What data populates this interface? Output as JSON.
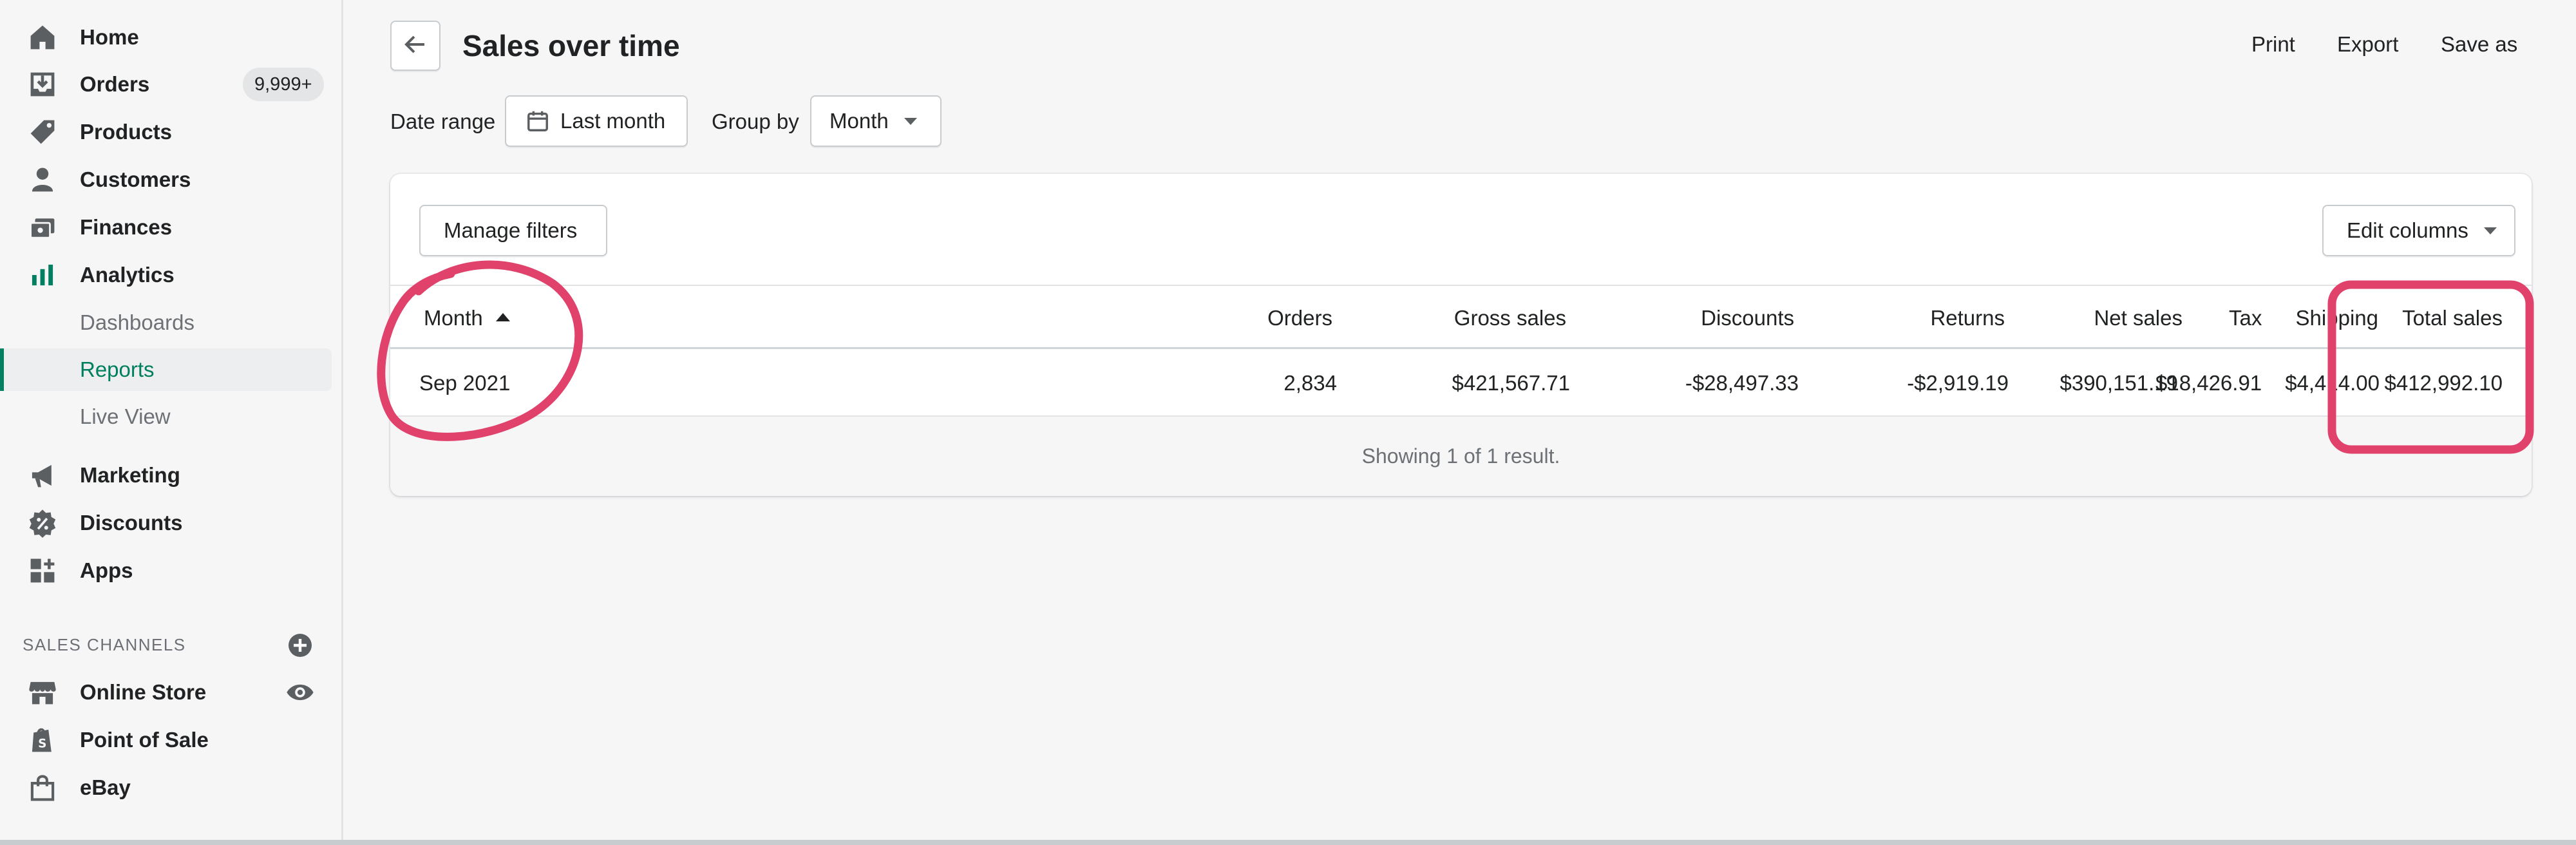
{
  "sidebar": {
    "items": [
      {
        "label": "Home",
        "icon": "home-icon"
      },
      {
        "label": "Orders",
        "icon": "orders-icon",
        "badge": "9,999+"
      },
      {
        "label": "Products",
        "icon": "tag-icon"
      },
      {
        "label": "Customers",
        "icon": "person-icon"
      },
      {
        "label": "Finances",
        "icon": "finances-icon"
      },
      {
        "label": "Analytics",
        "icon": "bar-chart-icon"
      },
      {
        "label": "Dashboards"
      },
      {
        "label": "Reports",
        "active": true
      },
      {
        "label": "Live View"
      },
      {
        "label": "Marketing",
        "icon": "megaphone-icon"
      },
      {
        "label": "Discounts",
        "icon": "discount-icon"
      },
      {
        "label": "Apps",
        "icon": "apps-icon"
      }
    ],
    "sales_channels_title": "SALES CHANNELS",
    "channels": [
      {
        "label": "Online Store",
        "icon": "store-icon"
      },
      {
        "label": "Point of Sale",
        "icon": "shopping-bag-icon"
      },
      {
        "label": "eBay",
        "icon": "bag-icon"
      }
    ]
  },
  "header": {
    "title": "Sales over time",
    "actions": [
      "Print",
      "Export",
      "Save as"
    ]
  },
  "filters": {
    "date_range_label": "Date range",
    "date_range_value": "Last month",
    "group_by_label": "Group by",
    "group_by_value": "Month"
  },
  "card": {
    "manage_filters": "Manage filters",
    "edit_columns": "Edit columns"
  },
  "table": {
    "columns": [
      "Month",
      "Orders",
      "Gross sales",
      "Discounts",
      "Returns",
      "Net sales",
      "Shipping",
      "Tax",
      "Total sales"
    ],
    "rows": [
      [
        "Sep 2021",
        "2,834",
        "$421,567.71",
        "-$28,497.33",
        "-$2,919.19",
        "$390,151.19",
        "$4,414.00",
        "$18,426.91",
        "$412,992.10"
      ]
    ],
    "footer": "Showing 1 of 1 result."
  },
  "colors": {
    "accent": "#008060",
    "annotation": "#e0426b"
  }
}
